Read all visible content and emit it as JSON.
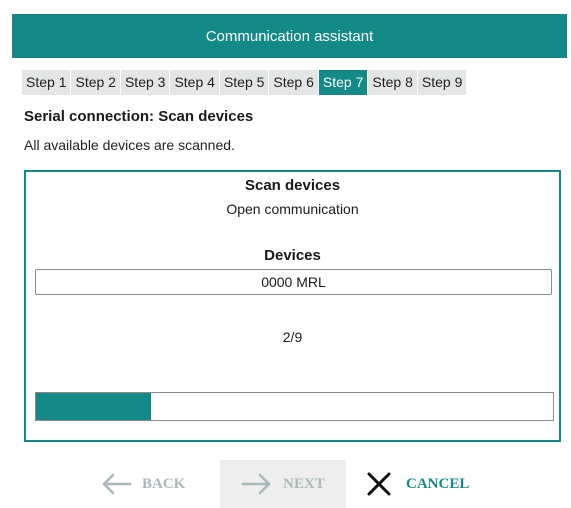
{
  "window": {
    "title": "Communication assistant"
  },
  "steps": [
    {
      "label": "Step 1",
      "active": false
    },
    {
      "label": "Step 2",
      "active": false
    },
    {
      "label": "Step 3",
      "active": false
    },
    {
      "label": "Step 4",
      "active": false
    },
    {
      "label": "Step 5",
      "active": false
    },
    {
      "label": "Step 6",
      "active": false
    },
    {
      "label": "Step 7",
      "active": true
    },
    {
      "label": "Step 8",
      "active": false
    },
    {
      "label": "Step 9",
      "active": false
    }
  ],
  "page": {
    "subtitle": "Serial connection: Scan devices",
    "description": "All available devices are scanned."
  },
  "panel": {
    "title": "Scan devices",
    "status": "Open communication",
    "devices_label": "Devices",
    "device_value": "0000 MRL",
    "progress_text": "2/9",
    "progress_fraction": 0.222
  },
  "nav": {
    "back_label": "BACK",
    "next_label": "NEXT",
    "cancel_label": "CANCEL",
    "back_icon": "arrow-left-icon",
    "next_icon": "arrow-right-icon",
    "cancel_icon": "close-icon"
  },
  "colors": {
    "accent": "#138a87",
    "disabled": "#a9b8b8"
  }
}
